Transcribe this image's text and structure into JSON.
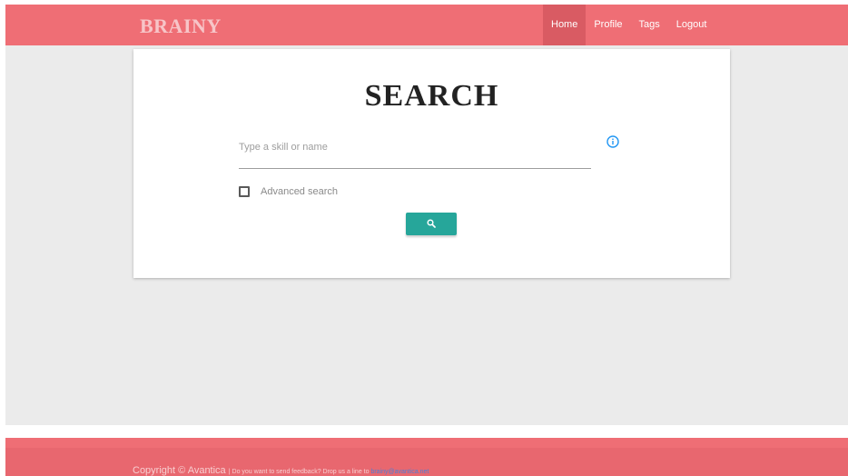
{
  "brand": "BRAINY",
  "nav": {
    "items": [
      {
        "label": "Home",
        "active": true
      },
      {
        "label": "Profile",
        "active": false
      },
      {
        "label": "Tags",
        "active": false
      },
      {
        "label": "Logout",
        "active": false
      }
    ]
  },
  "search": {
    "title": "SEARCH",
    "placeholder": "Type a skill or name",
    "value": "",
    "advanced_label": "Advanced search",
    "advanced_checked": false,
    "button_icon": "search-icon",
    "info_icon": "info-icon"
  },
  "footer": {
    "copyright": "Copyright © Avantica",
    "separator": " | ",
    "feedback": "Do you want to send feedback? Drop us a line to ",
    "email": "brainy@avantica.net"
  },
  "colors": {
    "header": "#ef6e75",
    "header_active": "#d95b63",
    "background": "#ebebeb",
    "button": "#26a69a",
    "info": "#2196f3"
  }
}
